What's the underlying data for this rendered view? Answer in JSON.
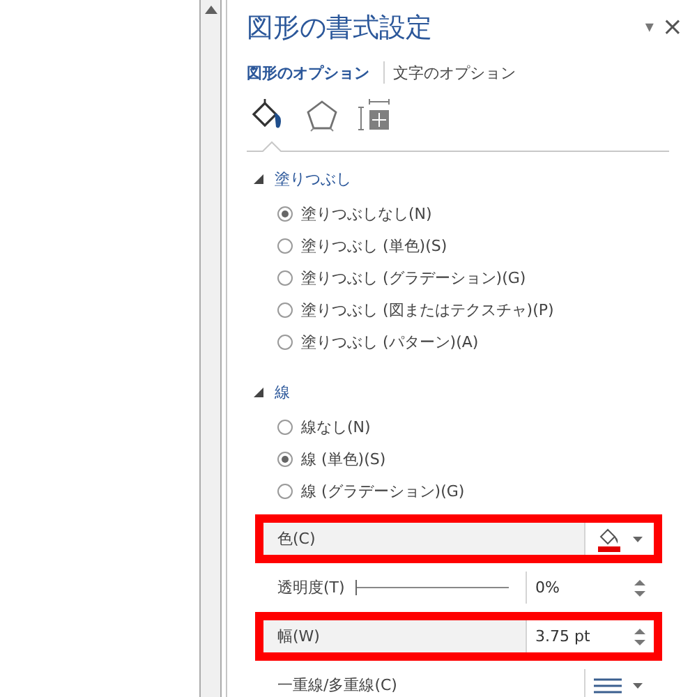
{
  "pane": {
    "title": "図形の書式設定",
    "menu_glyph": "▾",
    "close_glyph": "×"
  },
  "tabs": [
    {
      "label": "図形のオプション",
      "selected": true
    },
    {
      "label": "文字のオプション",
      "selected": false
    }
  ],
  "icon_tabs": [
    {
      "kind": "fill",
      "selected": true
    },
    {
      "kind": "effects",
      "selected": false
    },
    {
      "kind": "size",
      "selected": false
    }
  ],
  "sections": [
    {
      "title": "塗りつぶし",
      "expanded": true,
      "options": [
        {
          "label": "塗りつぶしなし(N)",
          "selected": true
        },
        {
          "label": "塗りつぶし (単色)(S)",
          "selected": false
        },
        {
          "label": "塗りつぶし (グラデーション)(G)",
          "selected": false
        },
        {
          "label": "塗りつぶし (図またはテクスチャ)(P)",
          "selected": false
        },
        {
          "label": "塗りつぶし (パターン)(A)",
          "selected": false
        }
      ]
    },
    {
      "title": "線",
      "expanded": true,
      "options": [
        {
          "label": "線なし(N)",
          "selected": false
        },
        {
          "label": "線 (単色)(S)",
          "selected": true
        },
        {
          "label": "線 (グラデーション)(G)",
          "selected": false
        }
      ],
      "properties": [
        {
          "kind": "color",
          "label": "色(C)",
          "color": "#e00000",
          "highlighted": true
        },
        {
          "kind": "slider",
          "label": "透明度(T)",
          "level": 0,
          "value": "0%",
          "highlighted": false
        },
        {
          "kind": "spin",
          "label": "幅(W)",
          "value": "3.75 pt",
          "highlighted": true
        },
        {
          "kind": "lines",
          "label": "一重線/多重線(C)",
          "highlighted": false
        }
      ]
    }
  ]
}
